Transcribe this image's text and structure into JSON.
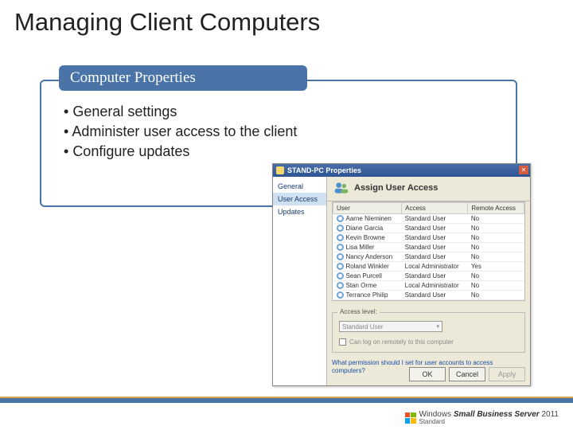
{
  "slide": {
    "title": "Managing Client Computers",
    "box_header": "Computer Properties",
    "bullets": [
      "General settings",
      "Administer user access to the client",
      "Configure updates"
    ]
  },
  "dialog": {
    "titlebar": "STAND-PC Properties",
    "close_glyph": "✕",
    "sidebar": [
      "General",
      "User Access",
      "Updates"
    ],
    "assign_title": "Assign User Access",
    "columns": [
      "User",
      "Access",
      "Remote Access"
    ],
    "rows": [
      {
        "user": "Aarne Nieminen",
        "access": "Standard User",
        "remote": "No"
      },
      {
        "user": "Diane Garcia",
        "access": "Standard User",
        "remote": "No"
      },
      {
        "user": "Kevin Browne",
        "access": "Standard User",
        "remote": "No"
      },
      {
        "user": "Lisa Miller",
        "access": "Standard User",
        "remote": "No"
      },
      {
        "user": "Nancy Anderson",
        "access": "Standard User",
        "remote": "No"
      },
      {
        "user": "Roland Winkler",
        "access": "Local Administrator",
        "remote": "Yes"
      },
      {
        "user": "Sean Purcell",
        "access": "Standard User",
        "remote": "No"
      },
      {
        "user": "Stan Orme",
        "access": "Local Administrator",
        "remote": "No"
      },
      {
        "user": "Terrance Philip",
        "access": "Standard User",
        "remote": "No"
      }
    ],
    "access_legend": "Access level:",
    "access_select": "Standard User",
    "checkbox_label": "Can log on remotely to this computer",
    "help_link": "What permission should I set for user accounts to access computers?",
    "buttons": {
      "ok": "OK",
      "cancel": "Cancel",
      "apply": "Apply"
    }
  },
  "footer": {
    "brand_prefix": "Windows ",
    "brand_main": "Small Business Server",
    "brand_year": "2011",
    "brand_sub": "Standard"
  }
}
